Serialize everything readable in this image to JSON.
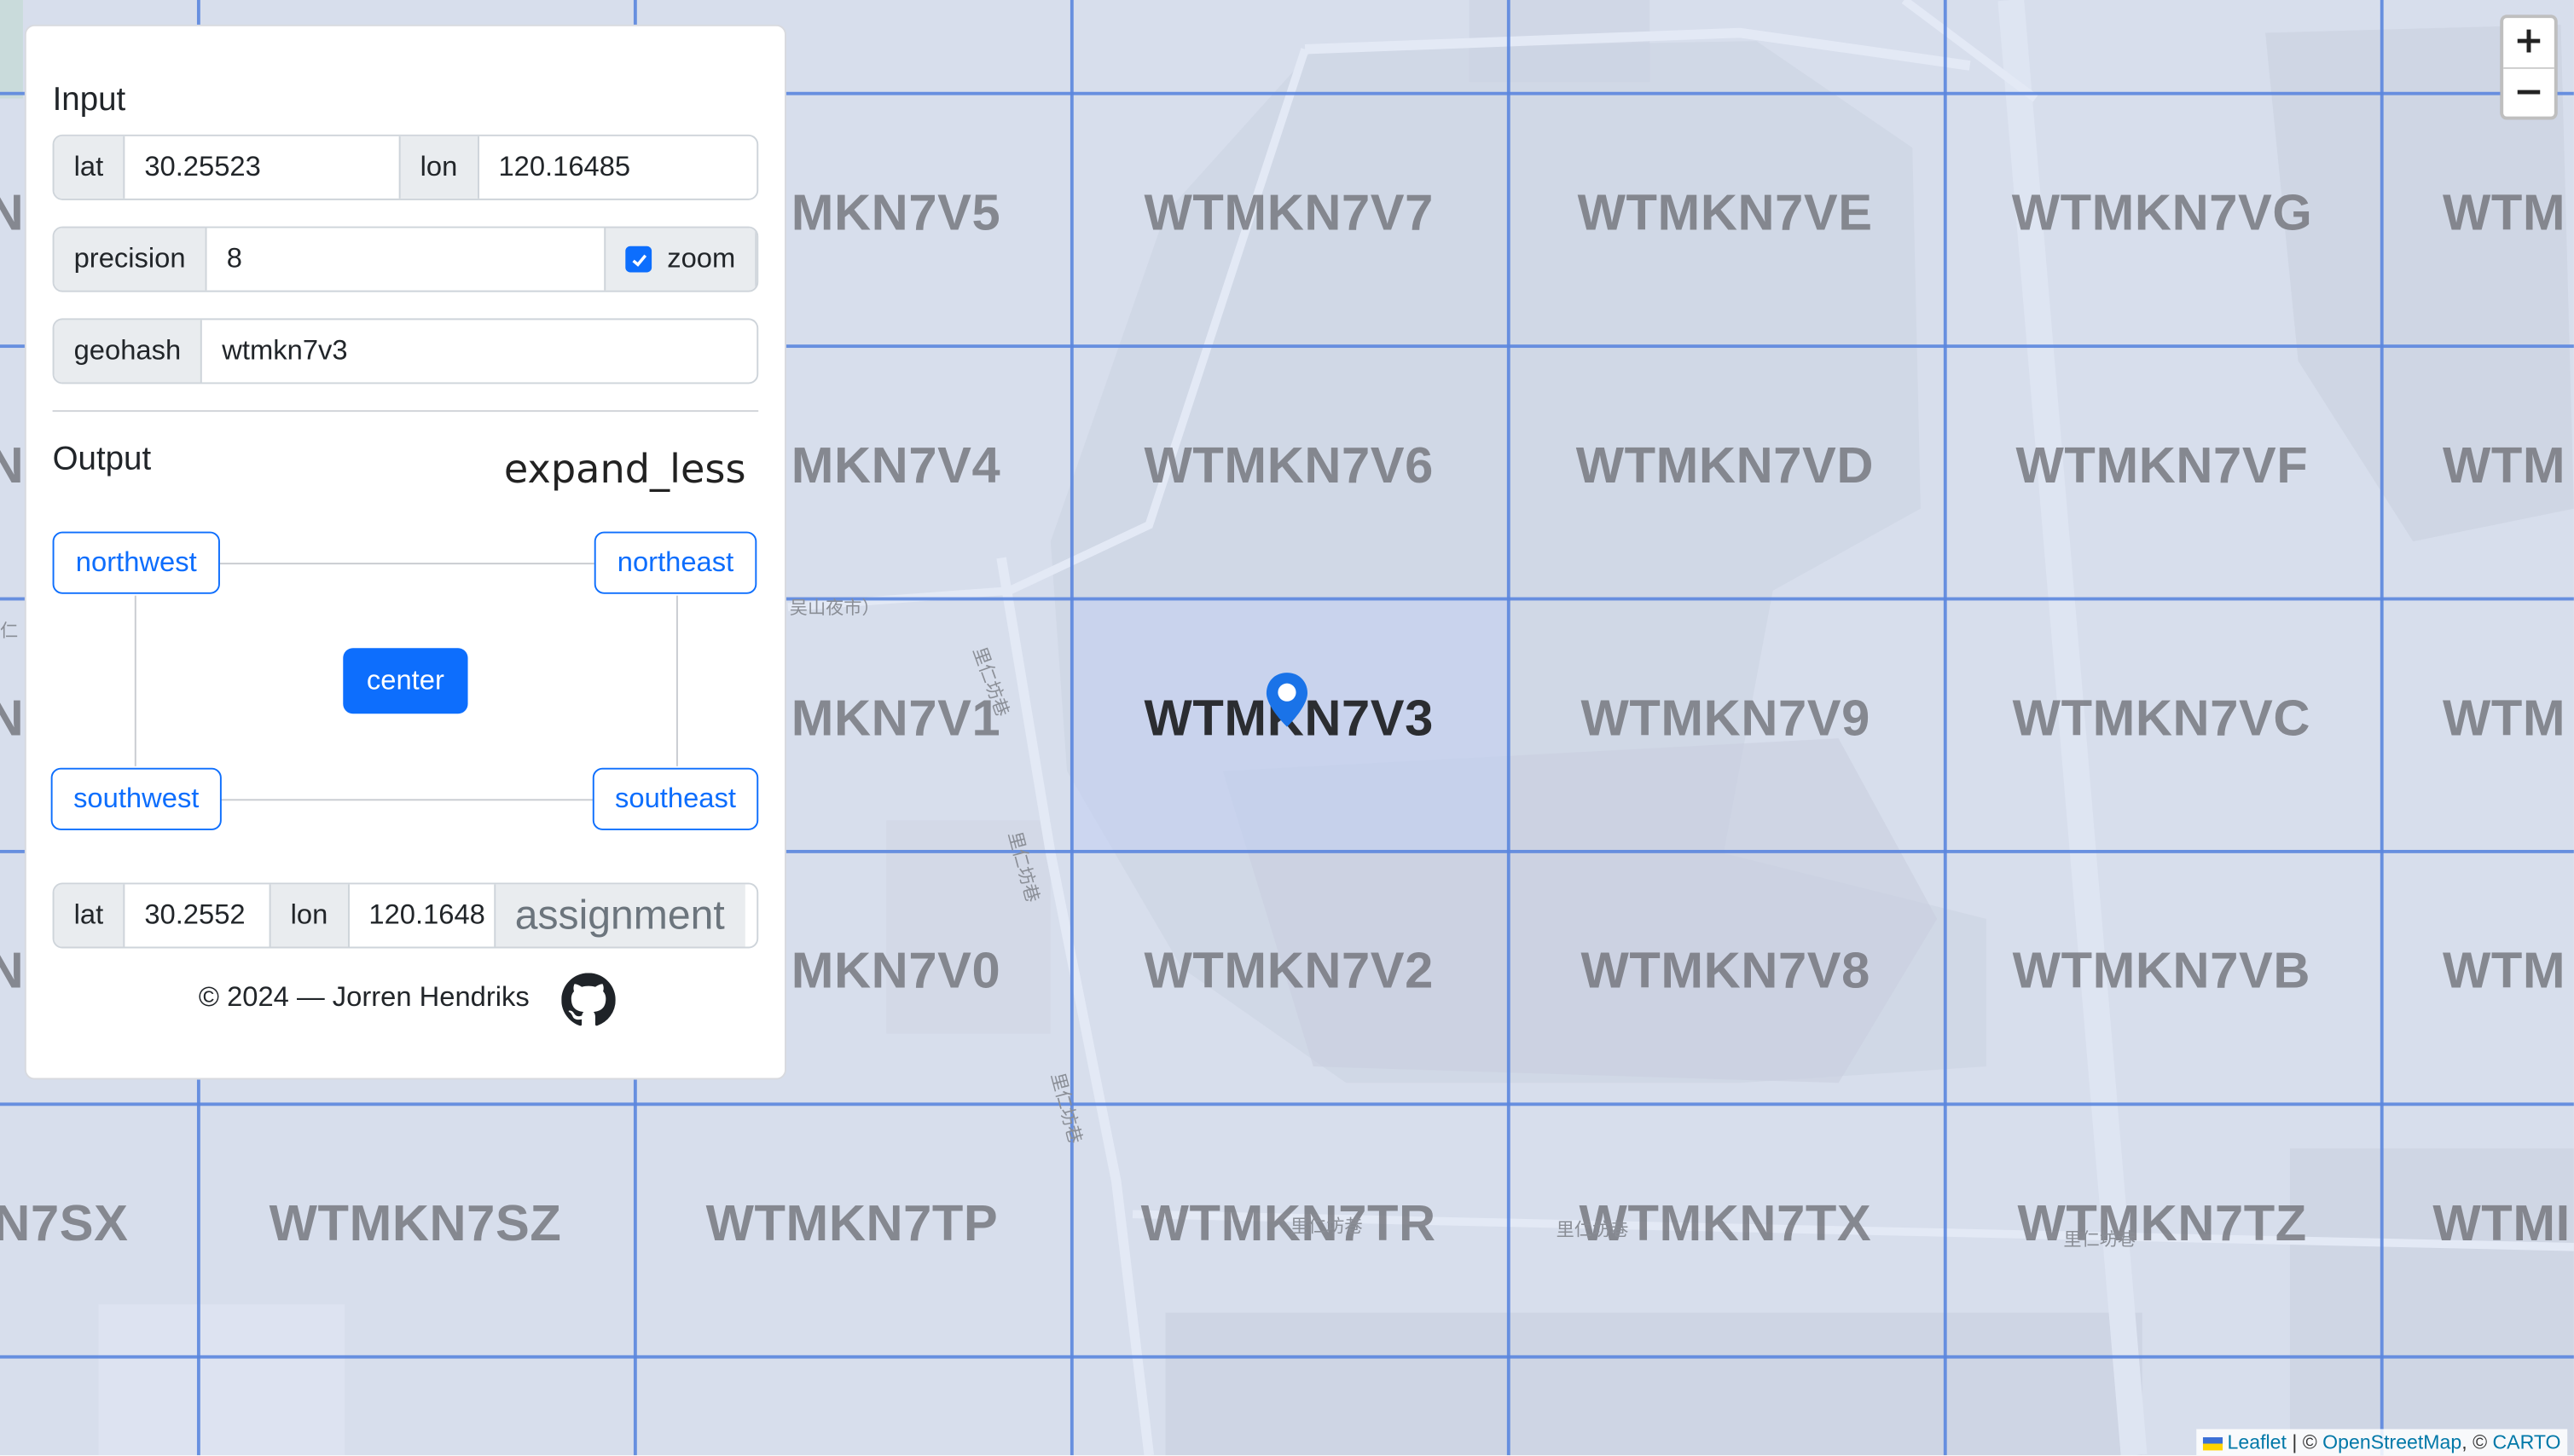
{
  "map": {
    "cells": [
      {
        "label": "N",
        "active": false
      },
      {
        "label": "MKN7V5",
        "active": false
      },
      {
        "label": "WTMKN7V7",
        "active": false
      },
      {
        "label": "WTMKN7VE",
        "active": false
      },
      {
        "label": "WTMKN7VG",
        "active": false
      },
      {
        "label": "WTM",
        "active": false
      },
      {
        "label": "N",
        "active": false
      },
      {
        "label": "MKN7V4",
        "active": false
      },
      {
        "label": "WTMKN7V6",
        "active": false
      },
      {
        "label": "WTMKN7VD",
        "active": false
      },
      {
        "label": "WTMKN7VF",
        "active": false
      },
      {
        "label": "WTM",
        "active": false
      },
      {
        "label": "N",
        "active": false
      },
      {
        "label": "MKN7V1",
        "active": false
      },
      {
        "label": "WTMKN7V3",
        "active": true
      },
      {
        "label": "WTMKN7V9",
        "active": false
      },
      {
        "label": "WTMKN7VC",
        "active": false
      },
      {
        "label": "WTM",
        "active": false
      },
      {
        "label": "N",
        "active": false
      },
      {
        "label": "MKN7V0",
        "active": false
      },
      {
        "label": "WTMKN7V2",
        "active": false
      },
      {
        "label": "WTMKN7V8",
        "active": false
      },
      {
        "label": "WTMKN7VB",
        "active": false
      },
      {
        "label": "WTM",
        "active": false
      },
      {
        "label": "N7SX",
        "active": false
      },
      {
        "label": "WTMKN7SZ",
        "active": false
      },
      {
        "label": "WTMKN7TP",
        "active": false
      },
      {
        "label": "WTMKN7TR",
        "active": false
      },
      {
        "label": "WTMKN7TX",
        "active": false
      },
      {
        "label": "WTMKN7TZ",
        "active": false
      },
      {
        "label": "WTMI",
        "active": false
      }
    ],
    "street_labels": [
      "吴山夜市）",
      "里仁坊巷",
      "里仁坊巷",
      "里仁坊巷",
      "里仁坊巷",
      "里仁坊巷",
      "里仁坊巷",
      "仁"
    ],
    "zoom_in": "+",
    "zoom_out": "−",
    "attribution": {
      "leaflet": "Leaflet",
      "sep1": " | © ",
      "osm": "OpenStreetMap",
      "sep2": ", © ",
      "carto": "CARTO"
    },
    "colors": {
      "grid": "#5b86de",
      "marker": "#1a73e8"
    }
  },
  "panel": {
    "input_title": "Input",
    "lat_label": "lat",
    "lat_value": "30.25523",
    "lon_label": "lon",
    "lon_value": "120.16485",
    "precision_label": "precision",
    "precision_value": "8",
    "zoom_label": "zoom",
    "zoom_checked": true,
    "geohash_label": "geohash",
    "geohash_value": "wtmkn7v3",
    "output_title": "Output",
    "expand_icon": "expand_less",
    "nw": "northwest",
    "ne": "northeast",
    "center": "center",
    "sw": "southwest",
    "se": "southeast",
    "out_lat_label": "lat",
    "out_lat_value": "30.2552",
    "out_lon_label": "lon",
    "out_lon_value": "120.1648",
    "assignment": "assignment",
    "footer": "© 2024 — Jorren Hendriks",
    "accent": "#0d6efd"
  }
}
